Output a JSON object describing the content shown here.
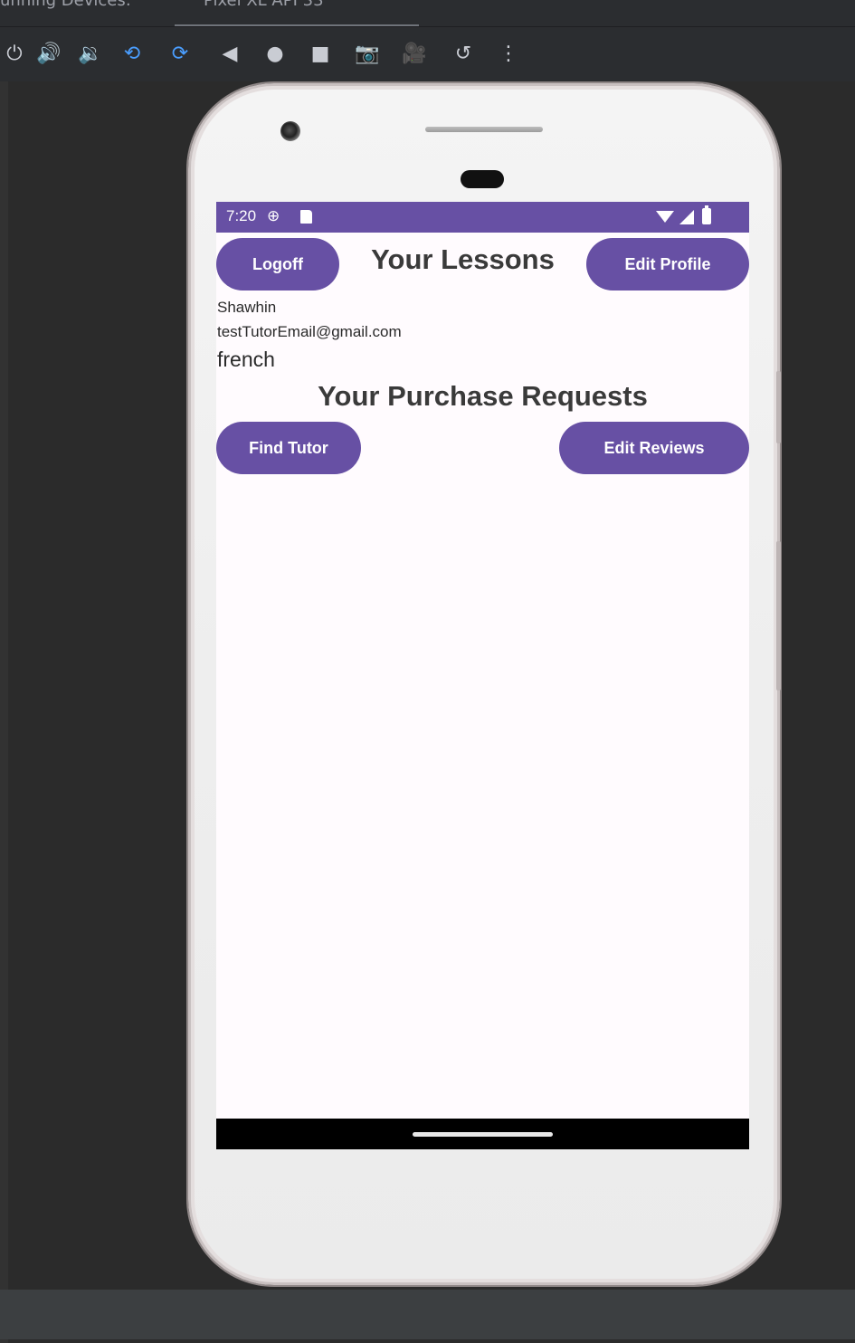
{
  "ide": {
    "tab_running_devices": "unning Devices:",
    "tab_device": "Pixel XL API 33",
    "toolbar_icons": [
      "power-icon",
      "volume-up-icon",
      "volume-down-icon",
      "rotate-left-icon",
      "rotate-right-icon",
      "back-icon",
      "home-icon",
      "overview-icon",
      "screenshot-icon",
      "record-icon",
      "snapshot-icon",
      "more-icon"
    ]
  },
  "status_bar": {
    "time": "7:20",
    "color": "#6750a4"
  },
  "header": {
    "logoff_label": "Logoff",
    "title": "Your Lessons",
    "edit_profile_label": "Edit Profile"
  },
  "profile": {
    "name": "Shawhin",
    "email": "testTutorEmail@gmail.com",
    "subject": "french"
  },
  "requests": {
    "title": "Your Purchase Requests",
    "find_tutor_label": "Find Tutor",
    "edit_reviews_label": "Edit Reviews"
  },
  "theme": {
    "primary": "#6750a4",
    "background": "#fffbfe"
  }
}
